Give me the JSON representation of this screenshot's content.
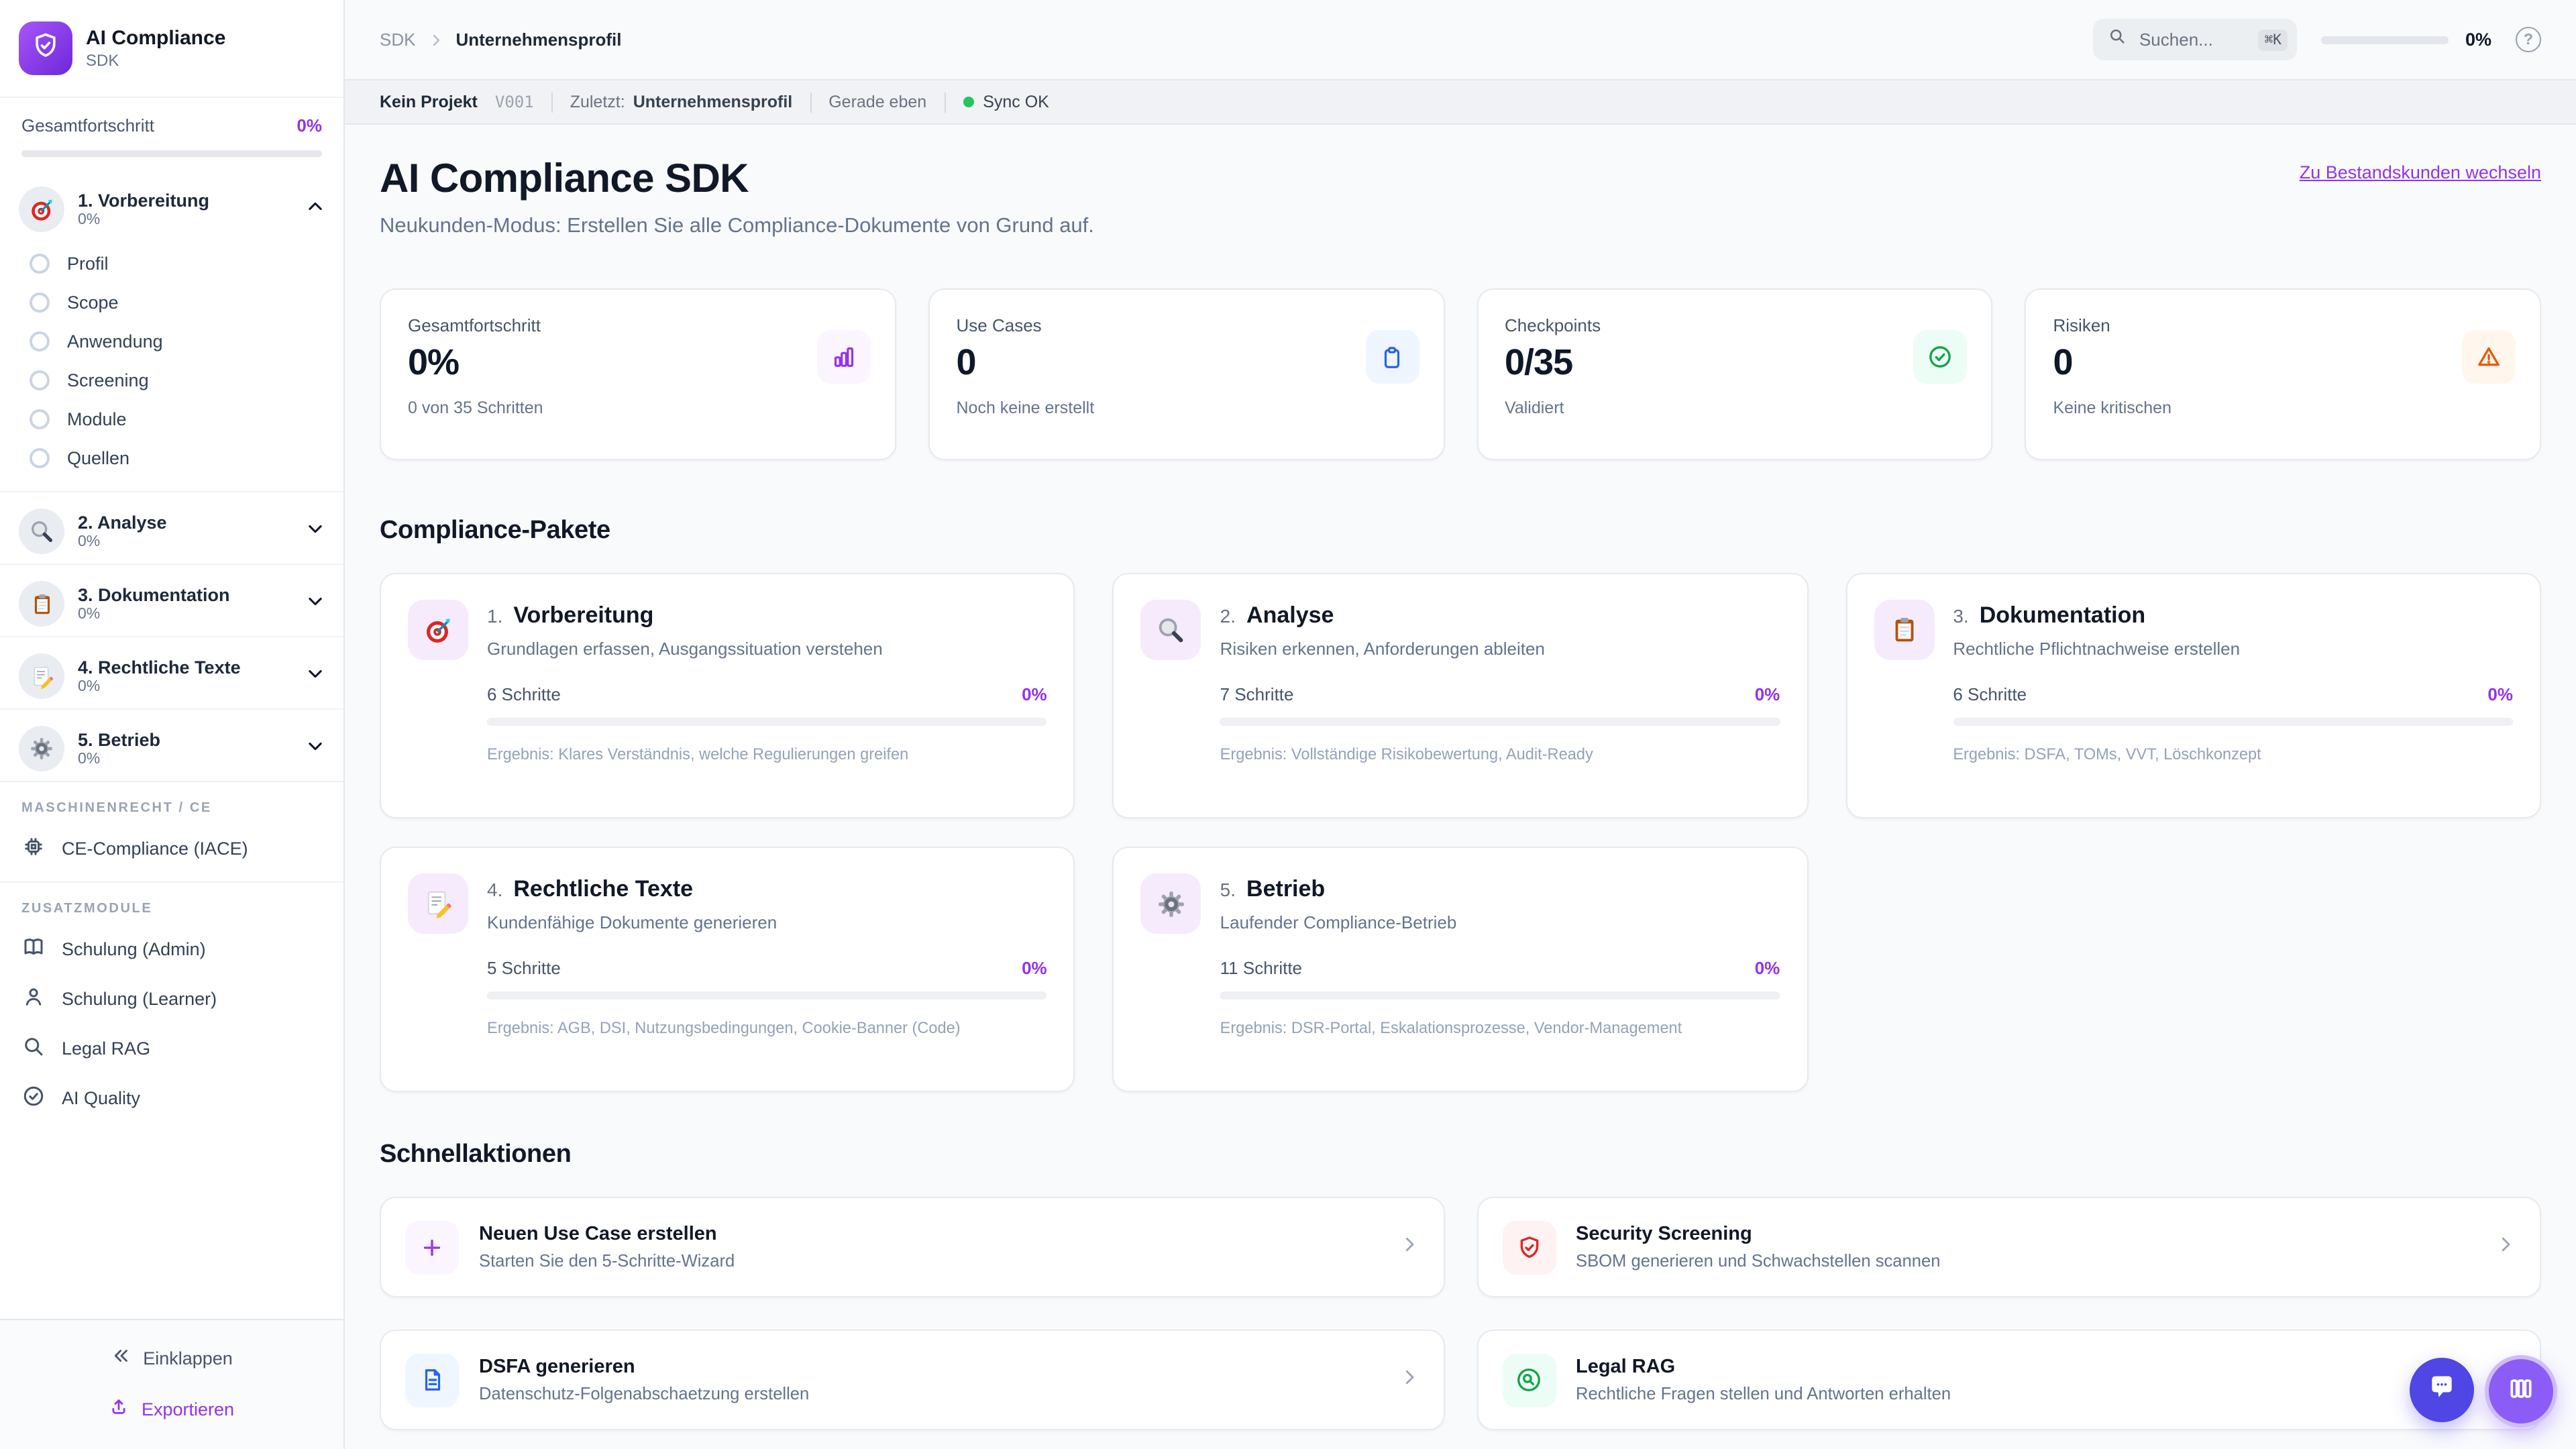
{
  "app": {
    "name": "AI Compliance",
    "badge": "SDK"
  },
  "sidebar": {
    "overall_label": "Gesamtfortschritt",
    "overall_value": "0%",
    "phases": [
      {
        "label": "1. Vorbereitung",
        "progress": "0%",
        "steps": [
          "Profil",
          "Scope",
          "Anwendung",
          "Screening",
          "Module",
          "Quellen"
        ]
      },
      {
        "label": "2. Analyse",
        "progress": "0%"
      },
      {
        "label": "3. Dokumentation",
        "progress": "0%"
      },
      {
        "label": "4. Rechtliche Texte",
        "progress": "0%"
      },
      {
        "label": "5. Betrieb",
        "progress": "0%"
      }
    ],
    "sections": [
      {
        "header": "MASCHINENRECHT / CE",
        "items": [
          {
            "label": "CE-Compliance (IACE)"
          }
        ]
      },
      {
        "header": "ZUSATZMODULE",
        "items": [
          {
            "label": "Schulung (Admin)"
          },
          {
            "label": "Schulung (Learner)"
          },
          {
            "label": "Legal RAG"
          },
          {
            "label": "AI Quality"
          }
        ]
      }
    ],
    "collapse_label": "Einklappen",
    "export_label": "Exportieren"
  },
  "topbar": {
    "breadcrumb_root": "SDK",
    "breadcrumb_current": "Unternehmensprofil",
    "search_placeholder": "Suchen...",
    "search_shortcut": "⌘K",
    "progress_value": "0%"
  },
  "statusbar": {
    "project": "Kein Projekt",
    "version": "V001",
    "last_label": "Zuletzt:",
    "last_value": "Unternehmensprofil",
    "updated": "Gerade eben",
    "sync": "Sync OK"
  },
  "page": {
    "title": "AI Compliance SDK",
    "subtitle": "Neukunden-Modus: Erstellen Sie alle Compliance-Dokumente von Grund auf.",
    "switch_link": "Zu Bestandskunden wechseln"
  },
  "stats": [
    {
      "label": "Gesamtfortschritt",
      "value": "0%",
      "sub": "0 von 35 Schritten",
      "icon": "bar-chart-icon"
    },
    {
      "label": "Use Cases",
      "value": "0",
      "sub": "Noch keine erstellt",
      "icon": "clipboard-icon"
    },
    {
      "label": "Checkpoints",
      "value": "0/35",
      "sub": "Validiert",
      "icon": "check-circle-icon"
    },
    {
      "label": "Risiken",
      "value": "0",
      "sub": "Keine kritischen",
      "icon": "warning-icon"
    }
  ],
  "packages": {
    "heading": "Compliance-Pakete",
    "cards": [
      {
        "num": "1.",
        "title": "Vorbereitung",
        "desc": "Grundlagen erfassen, Ausgangssituation verstehen",
        "steps": "6 Schritte",
        "progress": "0%",
        "result": "Ergebnis: Klares Verständnis, welche Regulierungen greifen",
        "icon": "target-icon"
      },
      {
        "num": "2.",
        "title": "Analyse",
        "desc": "Risiken erkennen, Anforderungen ableiten",
        "steps": "7 Schritte",
        "progress": "0%",
        "result": "Ergebnis: Vollständige Risikobewertung, Audit-Ready",
        "icon": "magnifier-icon"
      },
      {
        "num": "3.",
        "title": "Dokumentation",
        "desc": "Rechtliche Pflichtnachweise erstellen",
        "steps": "6 Schritte",
        "progress": "0%",
        "result": "Ergebnis: DSFA, TOMs, VVT, Löschkonzept",
        "icon": "clipboard-emoji-icon"
      },
      {
        "num": "4.",
        "title": "Rechtliche Texte",
        "desc": "Kundenfähige Dokumente generieren",
        "steps": "5 Schritte",
        "progress": "0%",
        "result": "Ergebnis: AGB, DSI, Nutzungsbedingungen, Cookie-Banner (Code)",
        "icon": "memo-icon"
      },
      {
        "num": "5.",
        "title": "Betrieb",
        "desc": "Laufender Compliance-Betrieb",
        "steps": "11 Schritte",
        "progress": "0%",
        "result": "Ergebnis: DSR-Portal, Eskalationsprozesse, Vendor-Management",
        "icon": "gear-icon"
      }
    ]
  },
  "quick_actions": {
    "heading": "Schnellaktionen",
    "items": [
      {
        "title": "Neuen Use Case erstellen",
        "desc": "Starten Sie den 5-Schritte-Wizard",
        "icon": "plus-icon"
      },
      {
        "title": "Security Screening",
        "desc": "SBOM generieren und Schwachstellen scannen",
        "icon": "shield-check-icon"
      },
      {
        "title": "DSFA generieren",
        "desc": "Datenschutz-Folgenabschaetzung erstellen",
        "icon": "document-icon"
      },
      {
        "title": "Legal RAG",
        "desc": "Rechtliche Fragen stellen und Antworten erhalten",
        "icon": "search-circle-icon"
      }
    ]
  },
  "colors": {
    "accent_purple": "#9333ea",
    "stat_blue": "#2563eb",
    "stat_green": "#16a34a",
    "stat_orange": "#ea580c",
    "sync_green": "#22c55e",
    "chat_button": "#4f46e5",
    "board_button": "#8b5cf6"
  }
}
